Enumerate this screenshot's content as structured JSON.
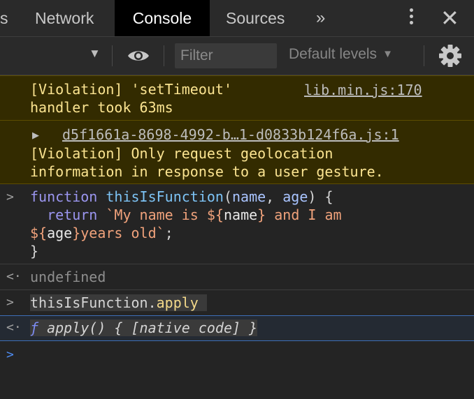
{
  "tabs": {
    "partial": "s",
    "network": "Network",
    "console": "Console",
    "sources": "Sources",
    "more": "»"
  },
  "toolbar": {
    "filter_placeholder": "Filter",
    "levels_label": "Default levels"
  },
  "messages": {
    "violation1": {
      "line1": "[Violation] 'setTimeout'",
      "line2": "handler took 63ms",
      "source": "lib.min.js:170"
    },
    "violation2": {
      "source": "d5f1661a-8698-4992-b…1-d0833b124f6a.js:1",
      "line1": "[Violation] Only request geolocation",
      "line2": "information in response to a user gesture."
    },
    "input1": {
      "l1_kw": "function",
      "l1_fn": "thisIsFunction",
      "l1_p1": "name",
      "l1_p2": "age",
      "l2_kw": "return",
      "l2_str1": "`My name is ",
      "l2_var1": "name",
      "l2_str2": " and I am",
      "l3_var2": "age",
      "l3_str3": "years old`",
      "l4": "}"
    },
    "result1": "undefined",
    "input2": {
      "obj": "thisIsFunction",
      "method": "apply"
    },
    "result2": {
      "f": "ƒ",
      "text": "apply() { [native code] }"
    }
  },
  "colors": {
    "violation_bg": "#332b00",
    "violation_text": "#fbe491",
    "prompt_blue": "#4e8cf0"
  }
}
